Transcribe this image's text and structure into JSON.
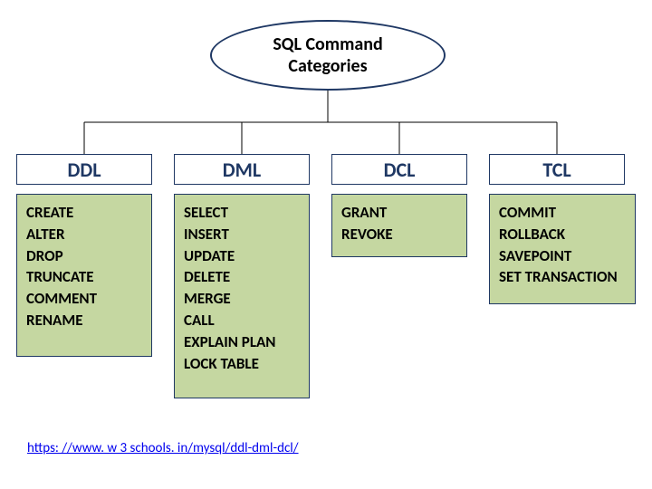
{
  "title": "SQL Command\nCategories",
  "categories": [
    {
      "name": "DDL",
      "commands": [
        "CREATE",
        "ALTER",
        "DROP",
        "TRUNCATE",
        "COMMENT",
        "RENAME"
      ]
    },
    {
      "name": "DML",
      "commands": [
        "SELECT",
        "INSERT",
        "UPDATE",
        "DELETE",
        "MERGE",
        "CALL",
        "EXPLAIN PLAN",
        "LOCK TABLE"
      ]
    },
    {
      "name": "DCL",
      "commands": [
        "GRANT",
        "REVOKE"
      ]
    },
    {
      "name": "TCL",
      "commands": [
        "COMMIT",
        "ROLLBACK",
        "SAVEPOINT",
        "SET TRANSACTION"
      ]
    }
  ],
  "footer_link": "https: //www. w 3 schools. in/mysql/ddl-dml-dcl/"
}
